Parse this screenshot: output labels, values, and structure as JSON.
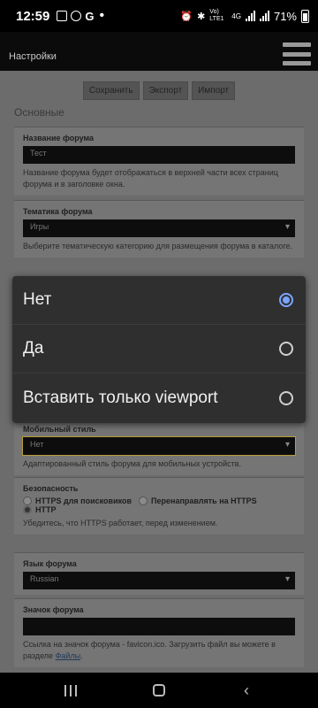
{
  "status_bar": {
    "time": "12:59",
    "network_label": "Vo) LTE1",
    "network_type": "4G",
    "battery": "71%",
    "left_icons": [
      "gallery-icon",
      "whatsapp-icon",
      "google-icon",
      "dot-icon"
    ],
    "right_icons": [
      "alarm-icon",
      "bluetooth-icon",
      "signal-icon",
      "battery-icon"
    ]
  },
  "header": {
    "title": "Настройки"
  },
  "toolbar": {
    "save_label": "Сохранить",
    "export_label": "Экспорт",
    "import_label": "Импорт"
  },
  "section": {
    "title": "Основные"
  },
  "fields": {
    "forum_name": {
      "label": "Название форума",
      "value": "Тест",
      "help": "Название форума будет отображаться в верхней части всех страниц форума и в заголовке окна."
    },
    "forum_topic": {
      "label": "Тематика форума",
      "value": "Игры",
      "help": "Выберите тематическую категорию для размещения форума в каталоге."
    },
    "mobile_style": {
      "label": "Мобильный стиль",
      "value": "Нет",
      "help": "Адаптированный стиль форума для мобильных устройств."
    },
    "security": {
      "label": "Безопасность",
      "options": [
        "HTTPS для поисковиков",
        "Перенаправлять на HTTPS",
        "HTTP"
      ],
      "selected": "HTTP",
      "help": "Убедитесь, что HTTPS работает, перед изменением."
    },
    "language": {
      "label": "Язык форума",
      "value": "Russian"
    },
    "favicon": {
      "label": "Значок форума",
      "value": "",
      "help_prefix": "Ссылка на значок форума - favicon.ico. Загрузить файл вы можете в разделе ",
      "help_link": "Файлы",
      "help_suffix": "."
    }
  },
  "dropdown": {
    "options": [
      "Нет",
      "Да",
      "Вставить только viewport"
    ],
    "selected": "Нет"
  },
  "colors": {
    "accent": "#7aa5ff",
    "page_bg": "#6c6c6c",
    "dropdown_bg": "#2f2f2f"
  }
}
